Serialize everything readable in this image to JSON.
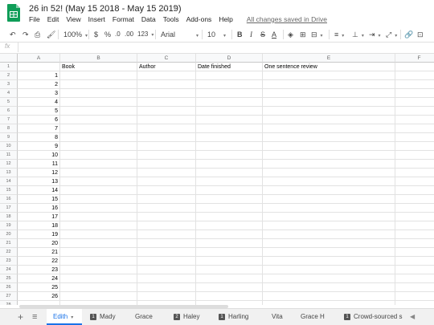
{
  "doc": {
    "title": "26 in 52! (May 15 2018 - May 15 2019)",
    "saved": "All changes saved in Drive"
  },
  "menu": [
    "File",
    "Edit",
    "View",
    "Insert",
    "Format",
    "Data",
    "Tools",
    "Add-ons",
    "Help"
  ],
  "toolbar": {
    "zoom": "100%",
    "currency": "$",
    "percent": "%",
    "dec_less": ".0",
    "dec_more": ".00",
    "more_formats": "123",
    "font": "Arial",
    "font_size": "10",
    "bold": "B",
    "italic": "I",
    "strike": "S",
    "text_color": "A"
  },
  "formula": {
    "fx": "fx"
  },
  "columns": [
    "A",
    "B",
    "C",
    "D",
    "E",
    "F"
  ],
  "headers": {
    "book": "Book",
    "author": "Author",
    "date": "Date finished",
    "review": "One sentence review"
  },
  "rows": [
    "1",
    "2",
    "3",
    "4",
    "5",
    "6",
    "7",
    "8",
    "9",
    "10",
    "11",
    "12",
    "13",
    "14",
    "15",
    "16",
    "17",
    "18",
    "19",
    "20",
    "21",
    "22",
    "23",
    "24",
    "25",
    "26"
  ],
  "row_numbers": [
    "1",
    "2",
    "3",
    "4",
    "5",
    "6",
    "7",
    "8",
    "9",
    "10",
    "11",
    "12",
    "13",
    "14",
    "15",
    "16",
    "17",
    "18",
    "19",
    "20",
    "21",
    "22",
    "23",
    "24",
    "25",
    "26",
    "27",
    "28"
  ],
  "sheets": [
    {
      "name": "Edith",
      "badge": "",
      "active": true
    },
    {
      "name": "Mady",
      "badge": "1"
    },
    {
      "name": "Grace",
      "badge": ""
    },
    {
      "name": "Haley",
      "badge": "2"
    },
    {
      "name": "Harling",
      "badge": "1"
    },
    {
      "name": "Vita",
      "badge": ""
    },
    {
      "name": "Grace H",
      "badge": ""
    },
    {
      "name": "Crowd-sourced s",
      "badge": "1"
    }
  ],
  "colors": {
    "accent": "#1a73e8",
    "logo": "#0f9d58"
  }
}
